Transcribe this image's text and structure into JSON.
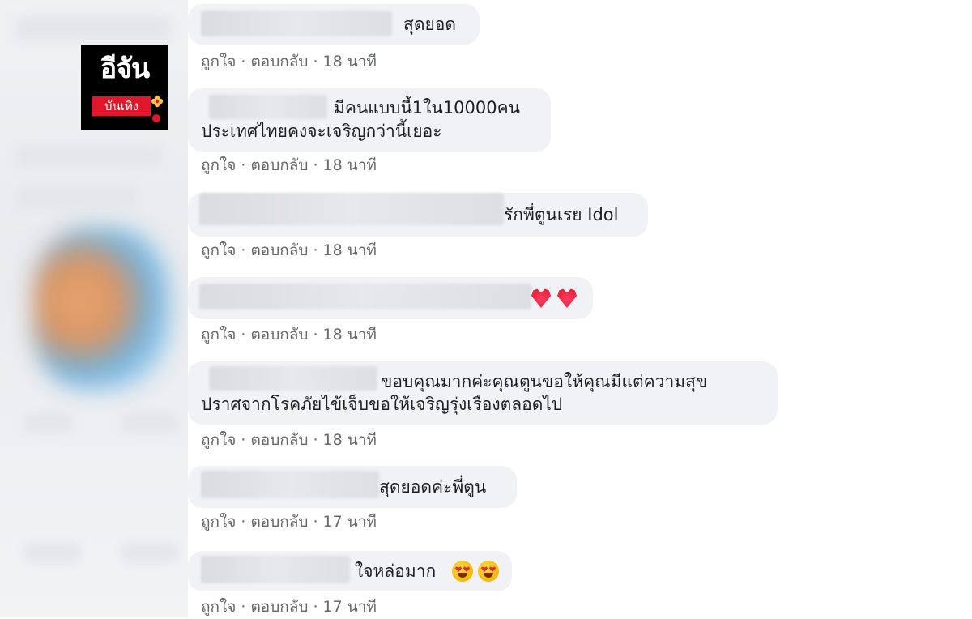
{
  "logo": {
    "main": "อีจัน",
    "sub": "บันเทิง"
  },
  "comments": [
    {
      "lines": [
        "สุดยอด"
      ],
      "like": "ถูกใจ",
      "reply": "ตอบกลับ",
      "time": "18 นาที",
      "reactions": []
    },
    {
      "lines": [
        "มีคนแบบนี้1ใน10000คน",
        "ประเทศไทยคงจะเจริญกว่านี้เยอะ"
      ],
      "like": "ถูกใจ",
      "reply": "ตอบกลับ",
      "time": "18 นาที",
      "reactions": []
    },
    {
      "lines": [
        "รักพี่ตูนเรย Idol"
      ],
      "like": "ถูกใจ",
      "reply": "ตอบกลับ",
      "time": "18 นาที",
      "reactions": []
    },
    {
      "lines": [
        ""
      ],
      "like": "ถูกใจ",
      "reply": "ตอบกลับ",
      "time": "18 นาที",
      "reactions": [
        "heart-icon",
        "heart-icon"
      ]
    },
    {
      "lines": [
        "ขอบคุณมากค่ะคุณตูนขอให้คุณมีแต่ความสุข",
        "ปราศจากโรคภัยไข้เจ็บขอให้เจริญรุ่งเรืองตลอดไป"
      ],
      "like": "ถูกใจ",
      "reply": "ตอบกลับ",
      "time": "18 นาที",
      "reactions": []
    },
    {
      "lines": [
        "สุดยอดค่ะพี่ตูน"
      ],
      "like": "ถูกใจ",
      "reply": "ตอบกลับ",
      "time": "17 นาที",
      "reactions": []
    },
    {
      "lines": [
        "ใจหล่อมาก"
      ],
      "like": "ถูกใจ",
      "reply": "ตอบกลับ",
      "time": "17 นาที",
      "reactions": [
        "heart-eyes-emoji-icon",
        "heart-eyes-emoji-icon"
      ]
    }
  ],
  "colors": {
    "bubble": "#f0f2f5",
    "text": "#1c1e21",
    "meta": "#65676b",
    "logo_red": "#e0162b"
  }
}
